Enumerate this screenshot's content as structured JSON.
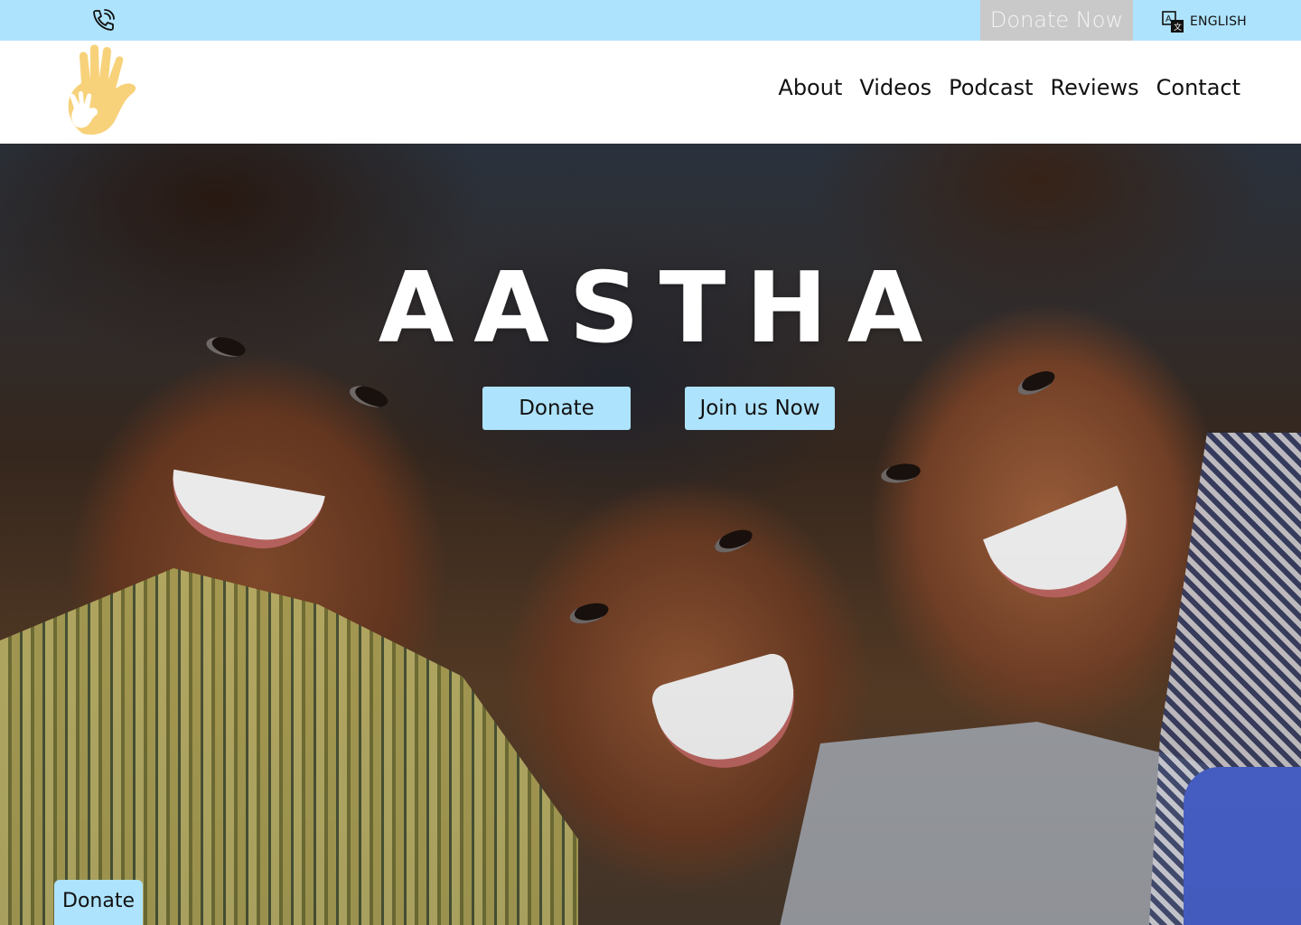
{
  "topbar": {
    "phone_icon": "phone-icon",
    "donate_now_label": "Donate Now",
    "language_icon": "translate-icon",
    "language_label": "ENGLISH"
  },
  "header": {
    "logo_icon": "hand-logo-icon",
    "nav": [
      "About",
      "Videos",
      "Podcast",
      "Reviews",
      "Contact"
    ]
  },
  "hero": {
    "title": "AASTHA",
    "donate_label": "Donate",
    "join_label": "Join us Now"
  },
  "floating": {
    "donate_label": "Donate"
  },
  "colors": {
    "accent": "#aee3fd",
    "donate_now_bg": "#c9c9c9",
    "logo": "#f7d27a"
  }
}
